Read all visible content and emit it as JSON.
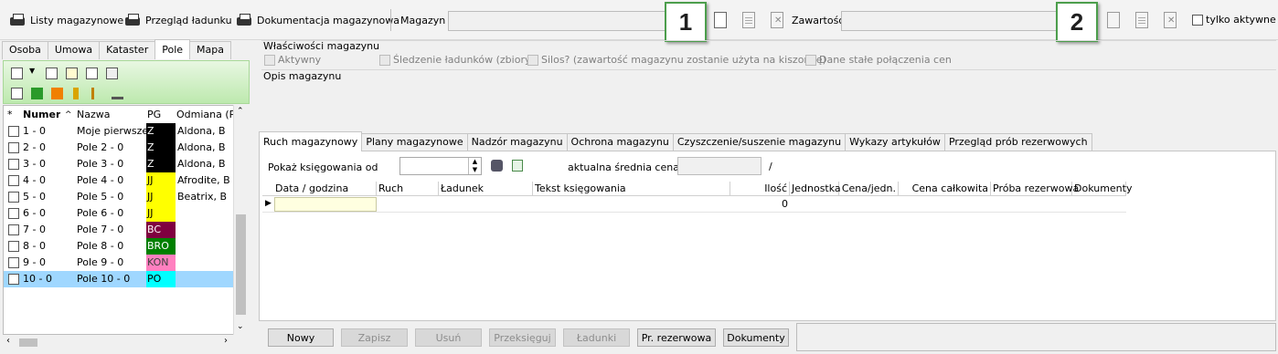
{
  "toolbar": {
    "btn1": "Listy magazynowe",
    "btn2": "Przegląd ładunku",
    "btn3": "Dokumentacja magazynowa",
    "magazyn_label": "Magazyn",
    "zawartosc_label": "Zawartość",
    "tylko_aktywne": "tylko aktywne",
    "marker1": "1",
    "marker2": "2"
  },
  "left": {
    "tabs": [
      "Osoba",
      "Umowa",
      "Kataster",
      "Pole",
      "Mapa"
    ],
    "active_tab": "Pole",
    "columns": [
      "*",
      "Numer",
      "Nazwa",
      "PG",
      "Odmiana (PG"
    ],
    "rows": [
      {
        "num": "1 - 0",
        "name": "Moje pierwsze p",
        "pg": "Z",
        "pg_bg": "#000000",
        "pg_fg": "#ffffff",
        "odm": "Aldona, B"
      },
      {
        "num": "2 - 0",
        "name": "Pole 2 - 0",
        "pg": "Z",
        "pg_bg": "#000000",
        "pg_fg": "#ffffff",
        "odm": "Aldona, B"
      },
      {
        "num": "3 - 0",
        "name": "Pole 3 - 0",
        "pg": "Z",
        "pg_bg": "#000000",
        "pg_fg": "#ffffff",
        "odm": "Aldona, B"
      },
      {
        "num": "4 - 0",
        "name": "Pole 4 - 0",
        "pg": "JJ",
        "pg_bg": "#ffff00",
        "pg_fg": "#000000",
        "odm": "Afrodite, B"
      },
      {
        "num": "5 - 0",
        "name": "Pole 5 - 0",
        "pg": "JJ",
        "pg_bg": "#ffff00",
        "pg_fg": "#000000",
        "odm": "Beatrix, B"
      },
      {
        "num": "6 - 0",
        "name": "Pole 6 - 0",
        "pg": "JJ",
        "pg_bg": "#ffff00",
        "pg_fg": "#000000",
        "odm": ""
      },
      {
        "num": "7 - 0",
        "name": "Pole 7 - 0",
        "pg": "BC",
        "pg_bg": "#800040",
        "pg_fg": "#ffffff",
        "odm": ""
      },
      {
        "num": "8 - 0",
        "name": "Pole 8 - 0",
        "pg": "BRO",
        "pg_bg": "#008000",
        "pg_fg": "#ffffff",
        "odm": ""
      },
      {
        "num": "9 - 0",
        "name": "Pole 9 - 0",
        "pg": "KON",
        "pg_bg": "#ff80c0",
        "pg_fg": "#404040",
        "odm": ""
      },
      {
        "num": "10 - 0",
        "name": "Pole 10 - 0",
        "pg": "PO",
        "pg_bg": "#00ffff",
        "pg_fg": "#000000",
        "odm": ""
      }
    ]
  },
  "props": {
    "title": "Właściwości magazynu",
    "aktywny": "Aktywny",
    "sledzenie": "Śledzenie ładunków (zbiory)",
    "silos": "Silos?  (zawartość magazynu zostanie użyta na kiszonkę)",
    "dane": "Dane stałe połączenia cen",
    "opis": "Opis magazynu"
  },
  "tabs": [
    "Ruch magazynowy",
    "Plany magazynowe",
    "Nadzór magazynu",
    "Ochrona magazynu",
    "Czyszczenie/suszenie magazynu",
    "Wykazy artykułów",
    "Przegląd prób rezerwowych"
  ],
  "ruch": {
    "pokaz": "Pokaż księgowania od",
    "srednia": "aktualna średnia cena",
    "slash": "/",
    "columns": [
      "Data / godzina",
      "Ruch",
      "Ładunek",
      "Tekst księgowania",
      "Ilość",
      "Jednostka",
      "Cena/jedn.",
      "Cena całkowita",
      "Próba rezerwowa",
      "Dokumenty"
    ],
    "row_ilosc": "0"
  },
  "buttons": {
    "nowy": "Nowy",
    "zapisz": "Zapisz",
    "usun": "Usuń",
    "przeksieguj": "Przeksięguj",
    "ladunki": "Ładunki",
    "pr_rez": "Pr. rezerwowa",
    "dokumenty": "Dokumenty"
  },
  "colors": {
    "accent_green": "#4c9e4c",
    "selection": "#9fd7ff"
  }
}
